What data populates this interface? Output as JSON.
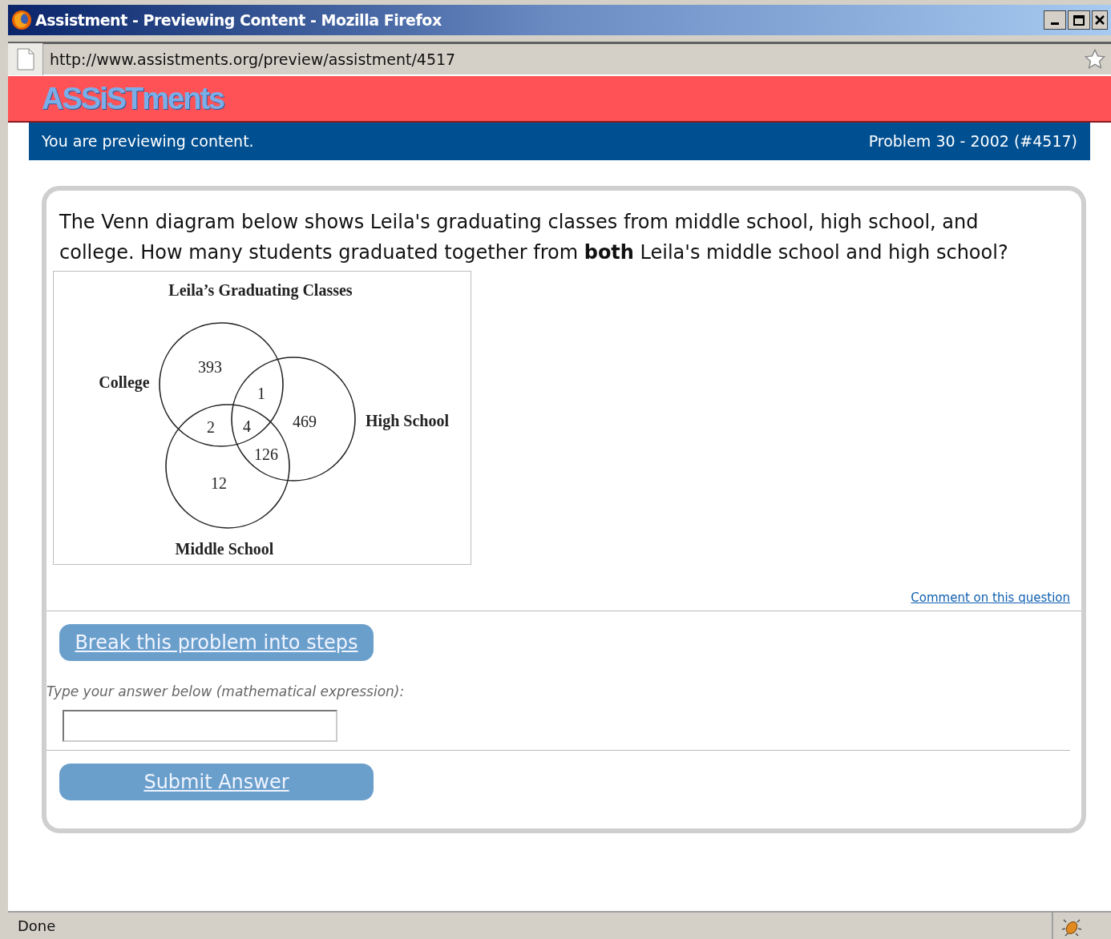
{
  "window": {
    "title": "Assistment - Previewing Content - Mozilla Firefox"
  },
  "address_bar": {
    "url": "http://www.assistments.org/preview/assistment/4517"
  },
  "site": {
    "logo": "ASSiSTments"
  },
  "preview_bar": {
    "message": "You are previewing content.",
    "problem": "Problem 30 - 2002 (#4517)"
  },
  "question": {
    "text": "The Venn diagram below shows Leila's graduating classes from middle school, high school, and college. How many students graduated together from **both** Leila's middle school and high school?",
    "diagram": {
      "title": "Leila’s Graduating Classes",
      "sets": [
        {
          "label": "College"
        },
        {
          "label": "High School"
        },
        {
          "label": "Middle School"
        }
      ],
      "regions": [
        {
          "value": "393"
        },
        {
          "value": "1"
        },
        {
          "value": "2"
        },
        {
          "value": "4"
        },
        {
          "value": "469"
        },
        {
          "value": "126"
        },
        {
          "value": "12"
        }
      ]
    },
    "comment_link": "Comment on this question",
    "steps_button": "Break this problem into steps",
    "answer_label": "Type your answer below (mathematical expression):",
    "submit_button": "Submit Answer"
  },
  "status_bar": {
    "text": "Done"
  }
}
